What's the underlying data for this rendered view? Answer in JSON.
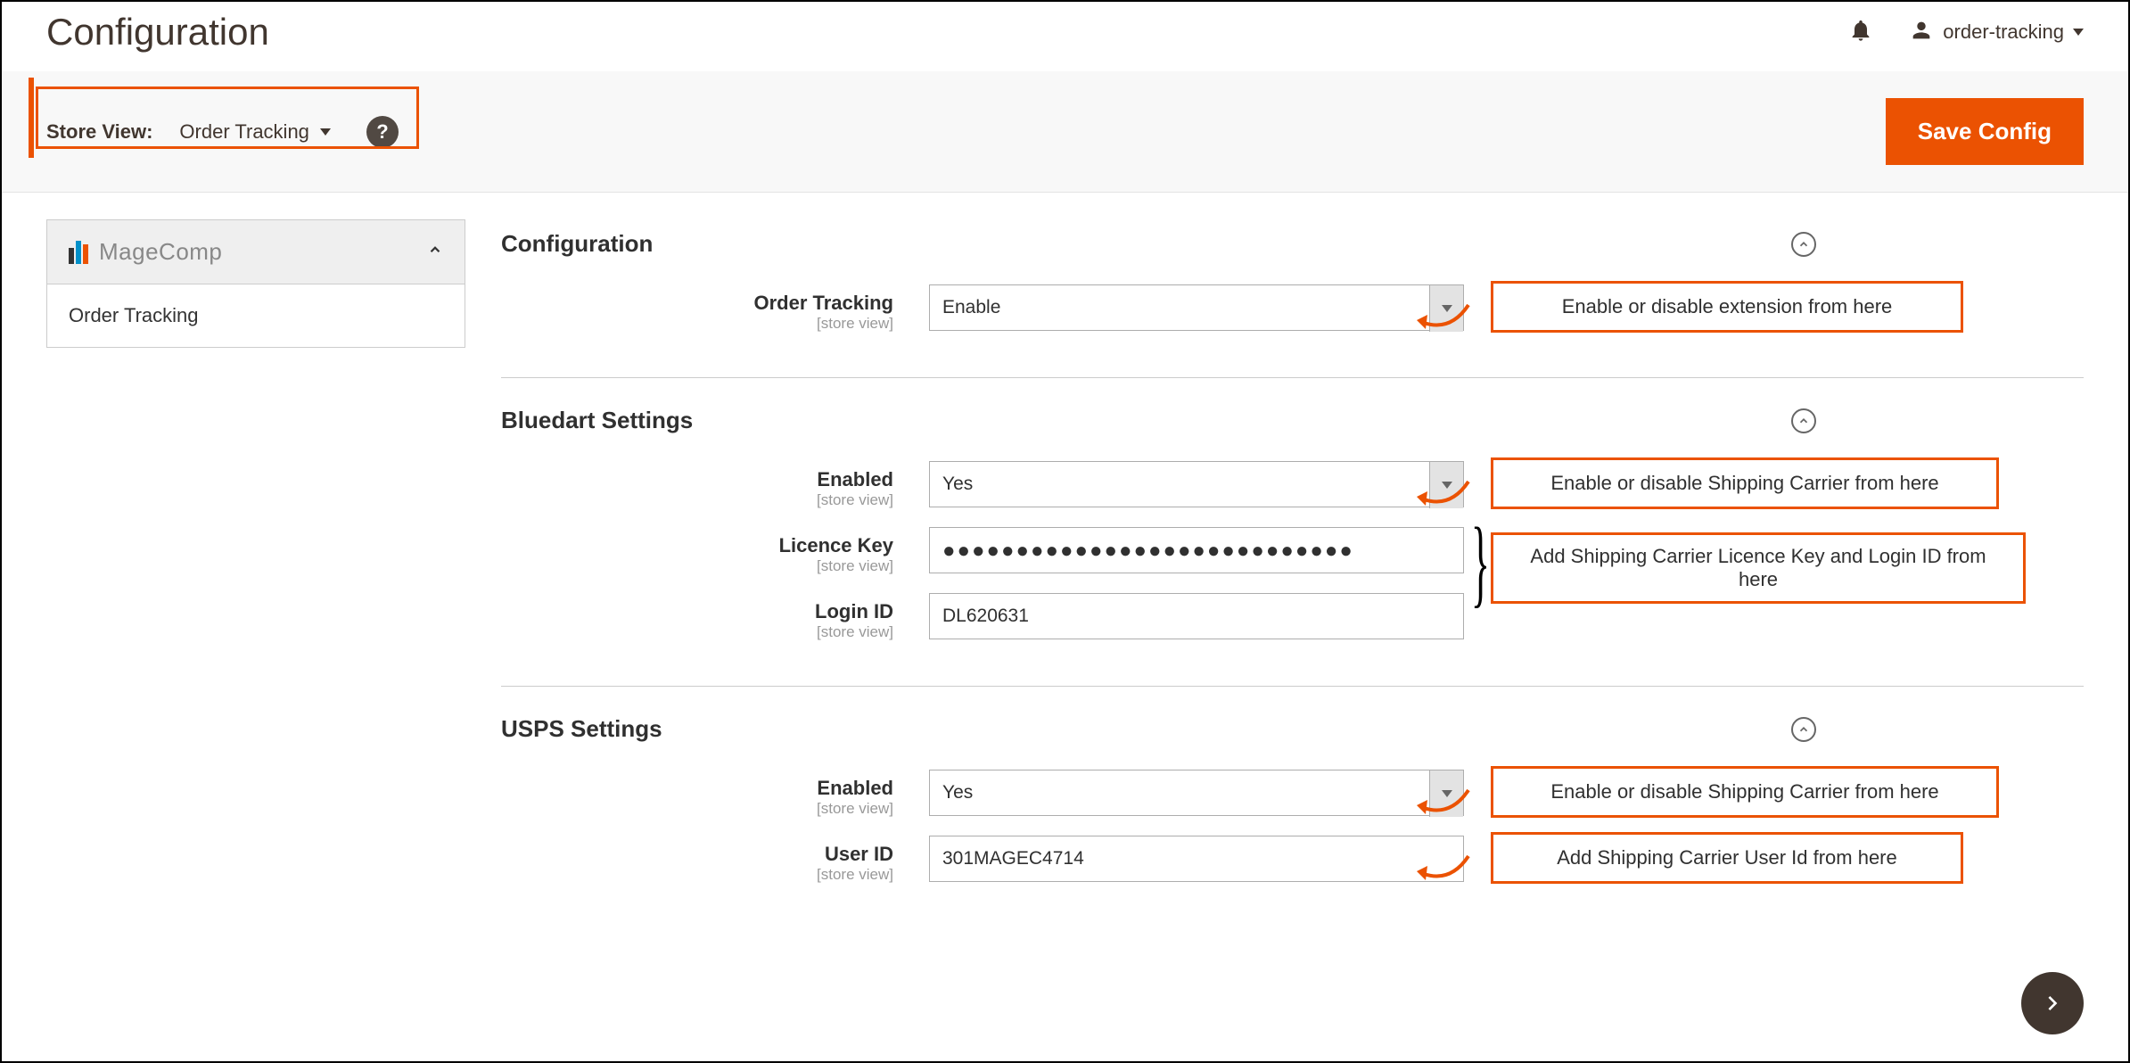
{
  "header": {
    "title": "Configuration",
    "user_name": "order-tracking"
  },
  "toolbar": {
    "store_view_label": "Store View:",
    "store_view_value": "Order Tracking",
    "help_icon": "?",
    "save_label": "Save Config"
  },
  "sidebar": {
    "brand": "MageComp",
    "items": [
      {
        "label": "Order Tracking",
        "active": true
      }
    ]
  },
  "sections": {
    "configuration": {
      "title": "Configuration",
      "fields": {
        "order_tracking": {
          "label": "Order Tracking",
          "scope": "[store view]",
          "value": "Enable"
        }
      },
      "annotations": {
        "order_tracking": "Enable or disable extension from here"
      }
    },
    "bluedart": {
      "title": "Bluedart Settings",
      "fields": {
        "enabled": {
          "label": "Enabled",
          "scope": "[store view]",
          "value": "Yes"
        },
        "licence_key": {
          "label": "Licence Key",
          "scope": "[store view]",
          "value": "●●●●●●●●●●●●●●●●●●●●●●●●●●●●"
        },
        "login_id": {
          "label": "Login ID",
          "scope": "[store view]",
          "value": "DL620631"
        }
      },
      "annotations": {
        "enabled": "Enable or disable Shipping Carrier from here",
        "key_login": "Add Shipping Carrier Licence Key and Login ID from here"
      }
    },
    "usps": {
      "title": "USPS Settings",
      "fields": {
        "enabled": {
          "label": "Enabled",
          "scope": "[store view]",
          "value": "Yes"
        },
        "user_id": {
          "label": "User ID",
          "scope": "[store view]",
          "value": "301MAGEC4714"
        }
      },
      "annotations": {
        "enabled": "Enable or disable Shipping Carrier from here",
        "user_id": "Add Shipping Carrier User Id from here"
      }
    }
  }
}
